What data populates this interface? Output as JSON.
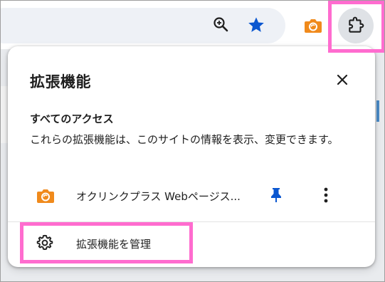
{
  "popup": {
    "title": "拡張機能",
    "access_heading": "すべてのアクセス",
    "access_description": "これらの拡張機能は、このサイトの情報を表示、変更できます。",
    "extensions": [
      {
        "name": "オクリンクプラス Webページス...",
        "icon": "orange-camera-icon",
        "pinned": true
      }
    ],
    "manage_label": "拡張機能を管理"
  },
  "toolbar": {
    "icons": [
      "zoom-icon",
      "bookmark-star-icon",
      "orange-camera-icon",
      "extensions-puzzle-icon"
    ]
  },
  "colors": {
    "accent_blue": "#0b57d0",
    "extension_orange": "#f08a1c",
    "highlight_pink": "#ff6ccf"
  }
}
